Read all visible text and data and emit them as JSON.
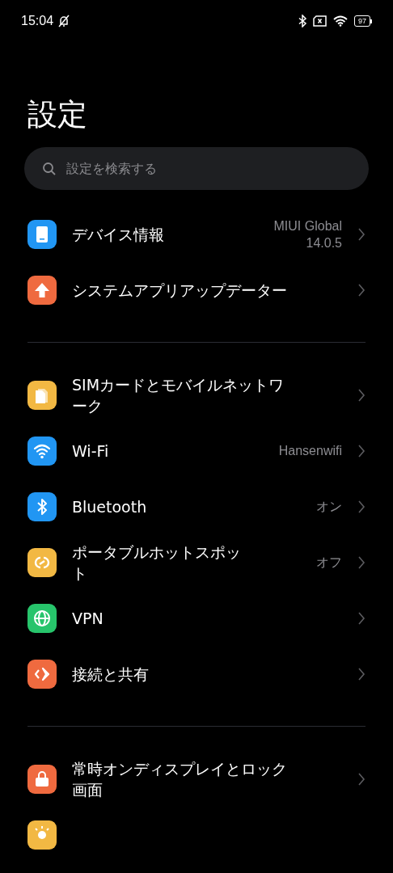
{
  "status_bar": {
    "time": "15:04",
    "battery": "97"
  },
  "title": "設定",
  "search": {
    "placeholder": "設定を検索する"
  },
  "sections": [
    {
      "items": [
        {
          "kind": "device",
          "label": "デバイス情報",
          "value": "MIUI Global\n14.0.5"
        },
        {
          "kind": "update",
          "label": "システムアプリアップデーター"
        }
      ]
    },
    {
      "items": [
        {
          "kind": "sim",
          "label": "SIMカードとモバイルネットワーク"
        },
        {
          "kind": "wifi",
          "label": "Wi-Fi",
          "value": "Hansenwifi"
        },
        {
          "kind": "bluetooth",
          "label": "Bluetooth",
          "value": "オン"
        },
        {
          "kind": "hotspot",
          "label": "ポータブルホットスポット",
          "value": "オフ"
        },
        {
          "kind": "vpn",
          "label": "VPN"
        },
        {
          "kind": "share",
          "label": "接続と共有"
        }
      ]
    },
    {
      "items": [
        {
          "kind": "lock",
          "label": "常時オンディスプレイとロック画面"
        },
        {
          "kind": "display"
        }
      ]
    }
  ]
}
